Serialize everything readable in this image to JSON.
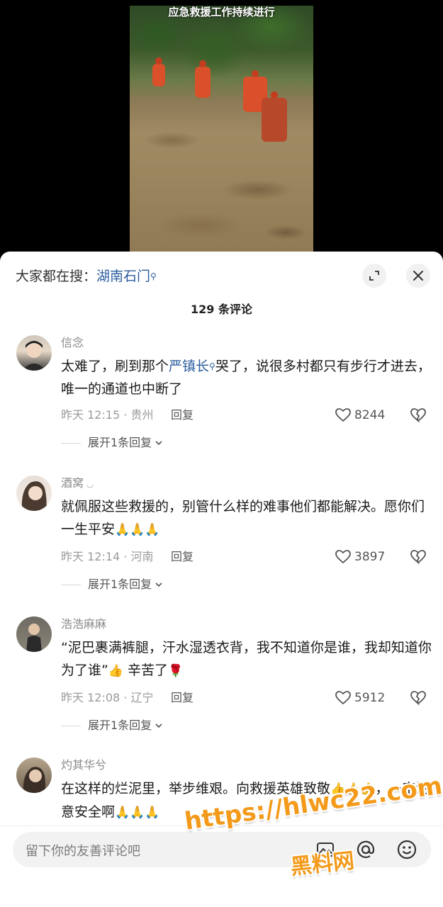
{
  "video": {
    "caption": "应急救援工作持续进行"
  },
  "sheet": {
    "search_prefix": "大家都在搜：",
    "search_keyword": "湖南石门",
    "comment_count_title": "129 条评论"
  },
  "comments": [
    {
      "username": "信念",
      "text_before_link": "太难了，刷到那个",
      "link": "严镇长",
      "text_after_link": "哭了，说很多村都只有步行才进去，唯一的通道也中断了",
      "time_location": "昨天 12:15 · 贵州",
      "reply_label": "回复",
      "likes": "8244",
      "expand_label": "展开1条回复"
    },
    {
      "username": "酒窝",
      "text": "就佩服这些救援的，别管什么样的难事他们都能解决。愿你们一生平安",
      "emojis": "🙏🙏🙏",
      "time_location": "昨天 12:14 · 河南",
      "reply_label": "回复",
      "likes": "3897",
      "expand_label": "展开1条回复"
    },
    {
      "username": "浩浩麻麻",
      "text": "“泥巴裹满裤腿，汗水湿透衣背，我不知道你是谁，我却知道你为了谁”",
      "emoji_mid": "👍",
      "text_tail": " 辛苦了",
      "emoji_end": "🌹",
      "time_location": "昨天 12:08 · 辽宁",
      "reply_label": "回复",
      "likes": "5912",
      "expand_label": "展开1条回复"
    },
    {
      "username": "灼其华兮",
      "text": "在这样的烂泥里，举步维艰。向救援英雄致敬",
      "emojis_a": "👍👍👍",
      "text_tail": "，一定注意安全啊",
      "emojis_b": "🙏🙏🙏"
    }
  ],
  "input": {
    "placeholder": "留下你的友善评论吧"
  },
  "watermark": {
    "line1": "https://hlwc22.com",
    "line2": "黑料网"
  },
  "colors": {
    "link": "#2b5c9e",
    "watermark": "#f39a1a",
    "sheet_bg": "#ffffff"
  }
}
